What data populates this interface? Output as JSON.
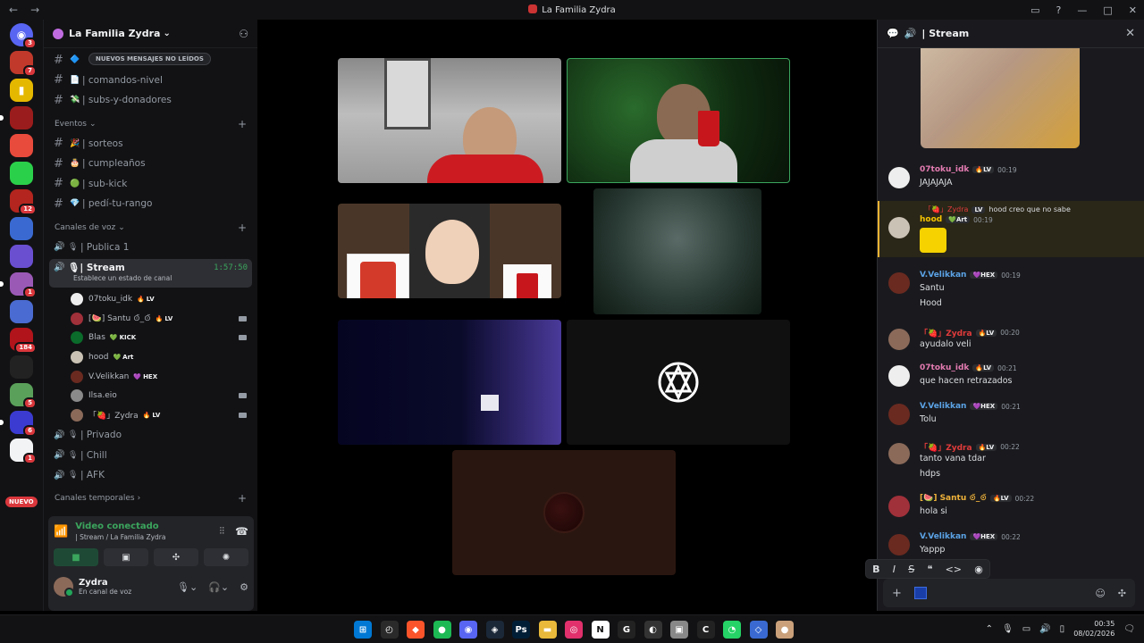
{
  "window": {
    "title": "La Familia Zydra",
    "nav_back": "←",
    "nav_forward": "→"
  },
  "servers": [
    {
      "color": "#5865f2",
      "badge": "3",
      "glyph": "◉"
    },
    {
      "color": "#c0392b",
      "badge": "7",
      "glyph": ""
    },
    {
      "color": "#e5b800",
      "badge": "",
      "glyph": "▮"
    },
    {
      "color": "#9b1c1c",
      "badge": "",
      "glyph": ""
    },
    {
      "color": "#e84a3c",
      "badge": "",
      "glyph": ""
    },
    {
      "color": "#2bd04a",
      "badge": "",
      "glyph": ""
    },
    {
      "color": "#b3251e",
      "badge": "12",
      "glyph": ""
    },
    {
      "color": "#3a6ad1",
      "badge": "",
      "glyph": ""
    },
    {
      "color": "#6a4fd1",
      "badge": "",
      "glyph": ""
    },
    {
      "color": "#9b59b6",
      "badge": "1",
      "glyph": ""
    },
    {
      "color": "#4a6bd1",
      "badge": "",
      "glyph": ""
    },
    {
      "color": "#b1141b",
      "badge": "184",
      "glyph": ""
    },
    {
      "color": "#222222",
      "badge": "",
      "glyph": ""
    },
    {
      "color": "#5aa05a",
      "badge": "5",
      "glyph": ""
    },
    {
      "color": "#3b3bd1",
      "badge": "6",
      "glyph": ""
    },
    {
      "color": "#f2f3f5",
      "badge": "1",
      "glyph": ""
    }
  ],
  "new_badge": "NUEVO",
  "sidebar": {
    "guild_name": "La Familia Zydra",
    "new_messages_pill": "NUEVOS MENSAJES NO LEÍDOS",
    "text_channels_top": [
      {
        "name": "",
        "emoji": "🔷"
      },
      {
        "name": "| comandos-nivel",
        "emoji": "📄"
      },
      {
        "name": "| subs-y-donadores",
        "emoji": "💸"
      }
    ],
    "events_category": "Eventos",
    "events_channels": [
      {
        "name": "| sorteos",
        "emoji": "🎉"
      },
      {
        "name": "| cumpleaños",
        "emoji": "🎂"
      },
      {
        "name": "| sub-kick",
        "emoji": "🟢"
      },
      {
        "name": "| pedí-tu-rango",
        "emoji": "💎"
      }
    ],
    "voice_category": "Canales de voz",
    "voice_channels_top": [
      {
        "name": "| Publica 1"
      }
    ],
    "active_voice": {
      "name": "| Stream",
      "timer": "1:57:50",
      "status": "Establece un estado de canal"
    },
    "voice_users": [
      {
        "name": "07toku_idk",
        "tag": "LV",
        "tag_emoji": "🔥",
        "camera": false,
        "avatar": "#eeeeee"
      },
      {
        "name": "[🍉] Santu ⊙̆_⊙̆",
        "tag": "LV",
        "tag_emoji": "🔥",
        "camera": true,
        "avatar": "#a0303a"
      },
      {
        "name": "Blas",
        "tag": "KICK",
        "tag_emoji": "💚",
        "camera": true,
        "avatar": "#0a6b2a"
      },
      {
        "name": "hood",
        "tag": "Art",
        "tag_emoji": "💚",
        "camera": false,
        "avatar": "#c9c2b5"
      },
      {
        "name": "V.Velikkan",
        "tag": "HEX",
        "tag_emoji": "💜",
        "camera": false,
        "avatar": "#6a2a20"
      },
      {
        "name": "Ilsa.eio",
        "tag": "",
        "tag_emoji": "",
        "camera": true,
        "avatar": "#8a8a8a"
      },
      {
        "name": "「🍓」Zydra",
        "tag": "LV",
        "tag_emoji": "🔥",
        "camera": true,
        "avatar": "#8b6a5a"
      }
    ],
    "voice_channels_bottom": [
      {
        "name": "| Privado"
      },
      {
        "name": "| Chill"
      },
      {
        "name": "| AFK"
      }
    ],
    "temp_category": "Canales temporales"
  },
  "voice_panel": {
    "title": "Video conectado",
    "subtitle": "| Stream / La Familia Zydra"
  },
  "user": {
    "name": "Zydra",
    "status": "En canal de voz"
  },
  "chat": {
    "title": "| Stream",
    "messages": [
      {
        "author": "07toku_idk",
        "color": "#e37bb1",
        "tag": "LV",
        "tag_emoji": "🔥",
        "time": "00:19",
        "lines": [
          "JAJAJAJA"
        ],
        "avatar": "#eeeeee"
      },
      {
        "author": "hood",
        "color": "#f5c400",
        "tag": "Art",
        "tag_emoji": "💚",
        "time": "00:19",
        "lines": [],
        "avatar": "#c9c2b5",
        "reply_author": "「🍓」Zydra",
        "reply_tag": "LV",
        "reply_text": "hood creo que no sabe"
      },
      {
        "author": "V.Velikkan",
        "color": "#5ba3e6",
        "tag": "HEX",
        "tag_emoji": "💜",
        "time": "00:19",
        "lines": [
          "Santu",
          "Hood"
        ],
        "avatar": "#6a2a20"
      },
      {
        "author": "「🍓」Zydra",
        "color": "#e23b3b",
        "tag": "LV",
        "tag_emoji": "🔥",
        "time": "00:20",
        "lines": [
          "ayudalo veli"
        ],
        "avatar": "#8b6a5a"
      },
      {
        "author": "07toku_idk",
        "color": "#e37bb1",
        "tag": "LV",
        "tag_emoji": "🔥",
        "time": "00:21",
        "lines": [
          "que hacen retrazados"
        ],
        "avatar": "#eeeeee"
      },
      {
        "author": "V.Velikkan",
        "color": "#5ba3e6",
        "tag": "HEX",
        "tag_emoji": "💜",
        "time": "00:21",
        "lines": [
          "Tolu"
        ],
        "avatar": "#6a2a20"
      },
      {
        "author": "「🍓」Zydra",
        "color": "#e23b3b",
        "tag": "LV",
        "tag_emoji": "🔥",
        "time": "00:22",
        "lines": [
          "tanto vana tdar",
          "hdps"
        ],
        "avatar": "#8b6a5a"
      },
      {
        "author": "[🍉] Santu ⊙̆_⊙̆",
        "color": "#f0b23a",
        "tag": "LV",
        "tag_emoji": "🔥",
        "time": "00:22",
        "lines": [
          "hola si"
        ],
        "avatar": "#a0303a"
      },
      {
        "author": "V.Velikkan",
        "color": "#5ba3e6",
        "tag": "HEX",
        "tag_emoji": "💜",
        "time": "00:22",
        "lines": [
          "Yappp"
        ],
        "avatar": "#6a2a20"
      }
    ]
  },
  "format_bar": [
    "B",
    "I",
    "S",
    "❝",
    "<>",
    "◉"
  ],
  "taskbar": {
    "apps": [
      {
        "color": "#0078d4",
        "glyph": "⊞"
      },
      {
        "color": "#2a2a2a",
        "glyph": "◴"
      },
      {
        "color": "#fb542b",
        "glyph": "◆"
      },
      {
        "color": "#1db954",
        "glyph": "●"
      },
      {
        "color": "#5865f2",
        "glyph": "◉"
      },
      {
        "color": "#1b2838",
        "glyph": "◈"
      },
      {
        "color": "#001e36",
        "glyph": "Ps"
      },
      {
        "color": "#e8b93a",
        "glyph": "▬"
      },
      {
        "color": "#e1306c",
        "glyph": "◎"
      },
      {
        "color": "#ffffff",
        "glyph": "N"
      },
      {
        "color": "#222222",
        "glyph": "G"
      },
      {
        "color": "#333333",
        "glyph": "◐"
      },
      {
        "color": "#888888",
        "glyph": "▣"
      },
      {
        "color": "#222222",
        "glyph": "C"
      },
      {
        "color": "#25d366",
        "glyph": "◔"
      },
      {
        "color": "#3a6ad1",
        "glyph": "◇"
      },
      {
        "color": "#c9a07a",
        "glyph": "●"
      }
    ],
    "time": "00:35",
    "date": "08/02/2026"
  }
}
